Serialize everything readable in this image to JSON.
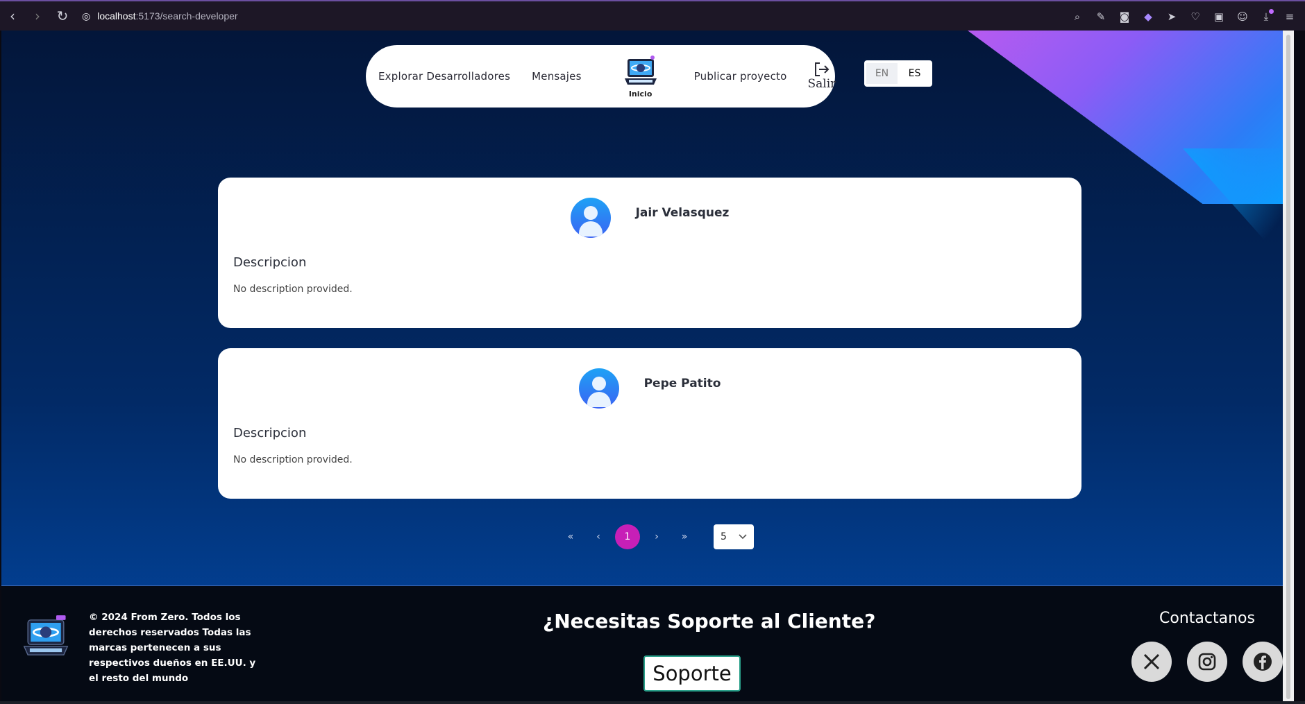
{
  "browser": {
    "url_host": "localhost",
    "url_path": ":5173/search-developer"
  },
  "navbar": {
    "explore": "Explorar Desarrolladores",
    "messages": "Mensajes",
    "logo_label": "Inicio",
    "publish": "Publicar proyecto",
    "logout": "Salir"
  },
  "language": {
    "en": "EN",
    "es": "ES",
    "active": "ES"
  },
  "developers": [
    {
      "name": "Jair Velasquez",
      "desc_title": "Descripcion",
      "desc": "No description provided."
    },
    {
      "name": "Pepe Patito",
      "desc_title": "Descripcion",
      "desc": "No description provided."
    }
  ],
  "pagination": {
    "first": "«",
    "prev": "‹",
    "current": "1",
    "next": "›",
    "last": "»",
    "page_size": "5"
  },
  "footer": {
    "copyright": "© 2024 From Zero. Todos los derechos reservados Todas las marcas pertenecen a sus respectivos dueños en EE.UU. y el resto del mundo",
    "need_support": "¿Necesitas Soporte al Cliente?",
    "support_button": "Soporte",
    "contact": "Contactanos",
    "socials": [
      "x-icon",
      "instagram-icon",
      "facebook-icon"
    ]
  }
}
